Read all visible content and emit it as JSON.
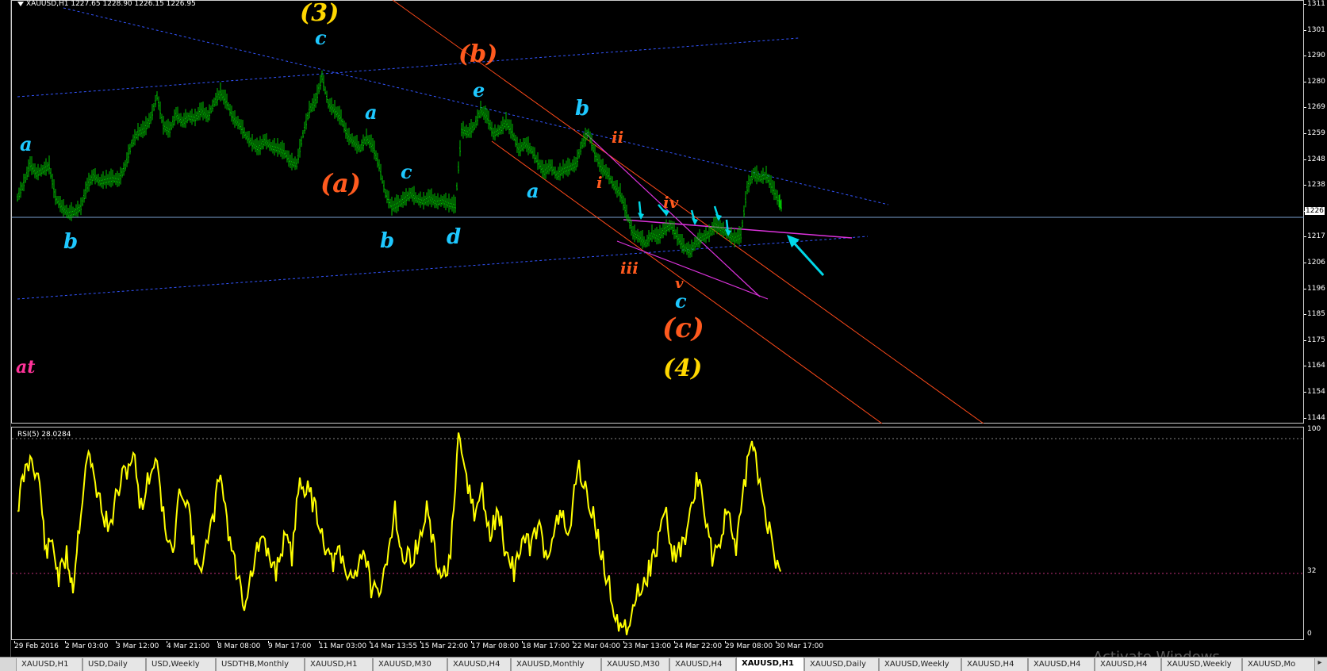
{
  "chart": {
    "symbol_info": "XAUUSD,H1  1227.65 1228.90 1226.15 1226.95",
    "rsi_info": "RSI(5) 28.0284",
    "current_price_label": "1226",
    "price_labels": [
      "1311",
      "1301",
      "1290",
      "1280",
      "1269",
      "1259",
      "1248",
      "1238",
      "1226",
      "1217",
      "1206",
      "1196",
      "1185",
      "1175",
      "1164",
      "1154",
      "1144"
    ],
    "rsi_scale_labels": {
      "top": "100",
      "level": "32",
      "bottom": "0"
    },
    "time_labels": [
      "29 Feb 2016",
      "2 Mar 03:00",
      "3 Mar 12:00",
      "4 Mar 21:00",
      "8 Mar 08:00",
      "9 Mar 17:00",
      "11 Mar 03:00",
      "14 Mar 13:55",
      "15 Mar 22:00",
      "17 Mar 08:00",
      "18 Mar 17:00",
      "22 Mar 04:00",
      "23 Mar 13:00",
      "24 Mar 22:00",
      "29 Mar 08:00",
      "30 Mar 17:00"
    ],
    "wave_labels": {
      "w3": "(3)",
      "c_top": "c",
      "b_paren": "(b)",
      "e": "e",
      "a_left": "a",
      "a_mid": "a",
      "a_right": "a",
      "b_right": "b",
      "ii": "ii",
      "i": "i",
      "a_paren": "(a)",
      "c_mid": "c",
      "iv": "iv",
      "b_left": "b",
      "b_mid": "b",
      "d": "d",
      "iii": "iii",
      "v": "v",
      "c_low": "c",
      "c_paren": "(c)",
      "w4": "(4)",
      "at": "at"
    },
    "colors": {
      "candles": "#00c000",
      "rsi": "#ffff00",
      "orange_label": "#ff5a1e",
      "blue_label": "#1ec8ff",
      "yellow_label": "#ffd700",
      "magenta": "#ff3399",
      "arrow": "#00d8e8",
      "channel": "#ff4a1a",
      "trend_blue": "#3355ff"
    }
  },
  "tabs": [
    "XAUUSD,H1",
    "USD,Daily",
    "USD,Weekly",
    "USDTHB,Monthly",
    "XAUUSD,H1",
    "XAUUSD,M30",
    "XAUUSD,H4",
    "XAUUSD,Monthly",
    "XAUUSD,M30",
    "XAUUSD,H4",
    "XAUUSD,H1",
    "XAUUSD,Daily",
    "XAUUSD,Weekly",
    "XAUUSD,H4",
    "XAUUSD,H4",
    "XAUUSD,H4",
    "XAUUSD,Weekly",
    "XAUUSD,Mo"
  ],
  "active_tab_index": 10,
  "tab_scroll_icon": "chevron-right-icon",
  "watermark": "Activate Windows"
}
